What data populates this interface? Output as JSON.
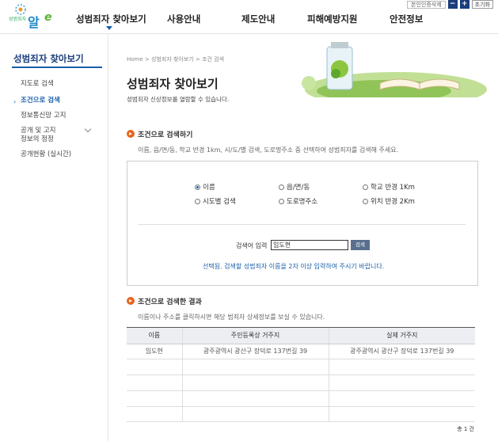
{
  "header": {
    "util": {
      "auth_label": "본인인증삭제",
      "zoom_in": "+",
      "zoom_out": "−",
      "reset_label": "초기화"
    },
    "gnb": [
      "성범죄자 찾아보기",
      "사용안내",
      "제도안내",
      "피해예방지원",
      "안전정보"
    ]
  },
  "lnb": {
    "title": "성범죄자 찾아보기",
    "items": [
      "지도로 검색",
      "조건으로 검색",
      "정보통신망 고지",
      "공개 및 고지\n정보의 정정",
      "공개현황 (실시간)"
    ]
  },
  "breadcrumb": [
    "Home",
    "성범죄자 찾아보기",
    "조건 검색"
  ],
  "page": {
    "title": "성범죄자 찾아보기",
    "desc": "성범죄자 신상정보를 열람할 수 있습니다."
  },
  "search": {
    "section_title": "조건으로 검색하기",
    "section_desc": "이름, 읍/면/동, 학교 반경 1km, 시/도/별 검색, 도로명주소 중 선택하여 성범죄자를 검색해 주세요.",
    "options": [
      "이름",
      "읍/면/동",
      "학교 반경 1Km",
      "시도별 검색",
      "도로명주소",
      "위치 반경 2Km"
    ],
    "selected": "이름",
    "input_label": "검색어 입력",
    "input_value": "임도현",
    "button_label": "검색",
    "notice": "선택됨. 검색할 성범죄자 이름을 2자 이상 입력하여 주시기 바랍니다."
  },
  "results": {
    "section_title": "조건으로 검색한 결과",
    "section_desc": "이름이나 주소를 클릭하시면 해당 범죄자 상세정보를 보실 수 있습니다.",
    "columns": [
      "이름",
      "주민등록상 거주지",
      "실제 거주지"
    ],
    "rows": [
      [
        "임도현",
        "광주광역시 광산구 장덕로 137번길 39",
        "광주광역시 광산구 장덕로 137번길 39"
      ]
    ],
    "total": "총 1 건"
  },
  "colors": {
    "brand": "#1a3d7c",
    "accent": "#1a5fa8",
    "section_icon": "#e5651e"
  }
}
